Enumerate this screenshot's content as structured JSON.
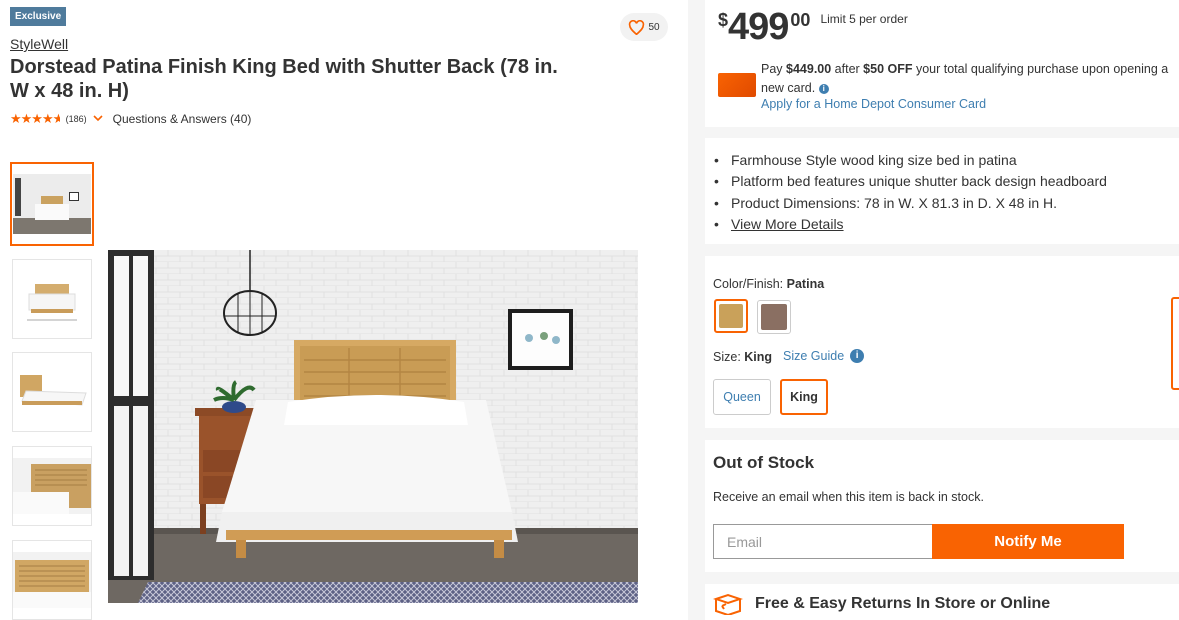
{
  "badge": {
    "label": "Exclusive"
  },
  "favorite": {
    "icon": "heart-outline-icon",
    "count": "50"
  },
  "product": {
    "brand": "StyleWell",
    "title": "Dorstead Patina Finish King Bed with Shutter Back (78 in. W x 48 in. H)",
    "rating": {
      "stars": 4.5,
      "count": "(186)",
      "qa_label": "Questions & Answers (40)"
    }
  },
  "gallery": {
    "thumbnails": [
      {
        "name": "thumb-room-scene",
        "selected": true
      },
      {
        "name": "thumb-bed-dimensions",
        "selected": false
      },
      {
        "name": "thumb-bed-angle",
        "selected": false
      },
      {
        "name": "thumb-headboard-closeup",
        "selected": false
      },
      {
        "name": "thumb-headboard-front",
        "selected": false
      }
    ]
  },
  "pricing": {
    "currency": "$",
    "dollars": "499",
    "cents": "00",
    "limit": "Limit 5 per order",
    "promo_pay": "Pay ",
    "promo_amount": "$449.00",
    "promo_after": " after ",
    "promo_off": "$50 OFF",
    "promo_rest": " your total qualifying purchase upon opening a new card.",
    "promo_link": "Apply for a Home Depot Consumer Card"
  },
  "highlights": {
    "items": [
      "Farmhouse Style wood king size bed in patina",
      "Platform bed features unique shutter back design headboard",
      "Product Dimensions: 78 in W. X 81.3 in D. X 48 in H."
    ],
    "more_link": "View More Details"
  },
  "options": {
    "color_label": "Color/Finish: ",
    "color_value": "Patina",
    "swatches": [
      {
        "name": "patina",
        "color": "#c9a15a",
        "selected": true
      },
      {
        "name": "brown",
        "color": "#8a6f62",
        "selected": false
      }
    ],
    "size_label": "Size: ",
    "size_value": "King",
    "size_guide": "Size Guide",
    "sizes": [
      {
        "label": "Queen",
        "selected": false
      },
      {
        "label": "King",
        "selected": true
      }
    ]
  },
  "stock": {
    "title": "Out of Stock",
    "subtitle": "Receive an email when this item is back in stock.",
    "email_placeholder": "Email",
    "notify_label": "Notify Me"
  },
  "returns": {
    "icon": "return-box-icon",
    "title": "Free & Easy Returns In Store or Online"
  },
  "colors": {
    "accent": "#f96302",
    "link": "#3e7eb0",
    "badge": "#4f7b9c"
  }
}
